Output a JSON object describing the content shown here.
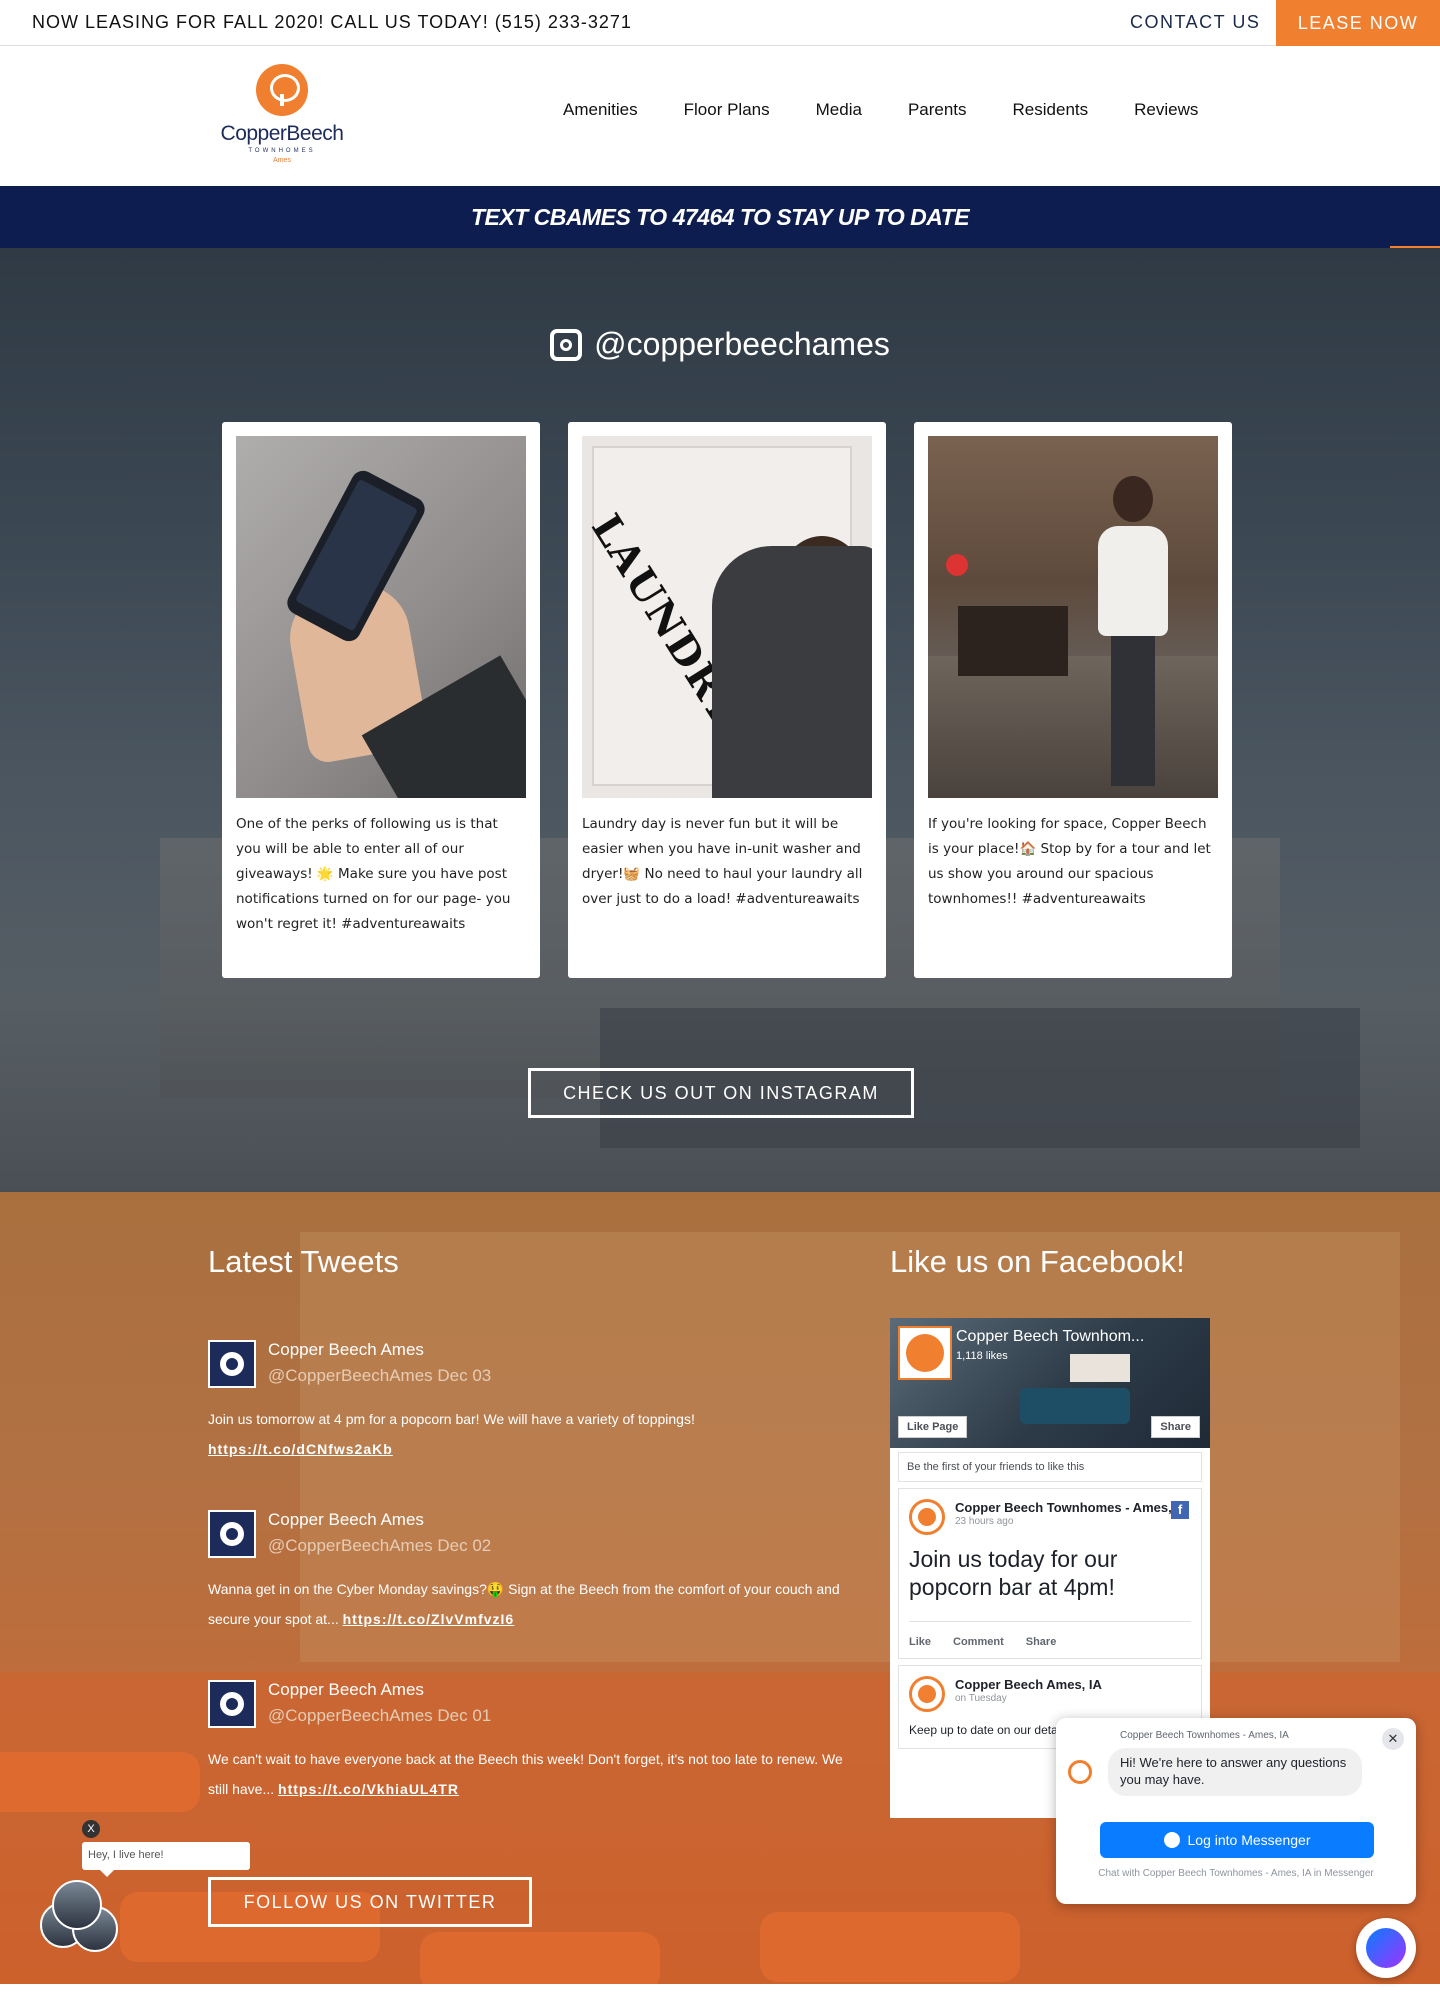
{
  "topbar": {
    "message": "NOW LEASING FOR FALL 2020! CALL US TODAY! (515) 233-3271",
    "contact": "CONTACT US",
    "lease": "LEASE NOW"
  },
  "logo": {
    "name": "CopperBeech",
    "sub": "TOWNHOMES",
    "city": "Ames"
  },
  "nav": {
    "items": [
      "Amenities",
      "Floor Plans",
      "Media",
      "Parents",
      "Residents",
      "Reviews"
    ],
    "active": "Media"
  },
  "text_banner": "TEXT CBAMES TO 47464 TO STAY UP TO DATE",
  "instagram": {
    "handle": "@copperbeechames",
    "posts": [
      {
        "caption": "One of the perks of following us is that you will be able to enter all of our giveaways! 🌟 Make sure you have post notifications turned on for our page- you won't regret it! #adventureawaits"
      },
      {
        "caption": "Laundry day is never fun but it will be easier when you have in-unit washer and dryer!🧺 No need to haul your laundry all over just to do a load! #adventureawaits"
      },
      {
        "caption": "If you're looking for space, Copper Beech is your place!🏠 Stop by for a tour and let us show you around our spacious townhomes!! #adventureawaits"
      }
    ],
    "laundry_word": "LAUNDRY",
    "button": "CHECK US OUT ON INSTAGRAM"
  },
  "tweets": {
    "title": "Latest Tweets",
    "items": [
      {
        "name": "Copper Beech Ames",
        "handle": "@CopperBeechAmes Dec 03",
        "text": "Join us tomorrow at 4 pm for a popcorn bar! We will have a variety of toppings!",
        "link": "https://t.co/dCNfws2aKb"
      },
      {
        "name": "Copper Beech Ames",
        "handle": "@CopperBeechAmes Dec 02",
        "text": "Wanna get in on the Cyber Monday savings?🤑 Sign at the Beech from the comfort of your couch and secure your spot at...",
        "link": "https://t.co/ZlvVmfvzI6"
      },
      {
        "name": "Copper Beech Ames",
        "handle": "@CopperBeechAmes Dec 01",
        "text": "We can't wait to have everyone back at the Beech this week! Don't forget, it's not too late to renew. We still have...",
        "link": "https://t.co/VkhiaUL4TR"
      }
    ],
    "button": "FOLLOW US ON TWITTER"
  },
  "facebook": {
    "title": "Like us on Facebook!",
    "page_name": "Copper Beech Townhom...",
    "likes": "1,118 likes",
    "like_page": "Like Page",
    "share": "Share",
    "friends": "Be the first of your friends to like this",
    "post1": {
      "name": "Copper Beech Townhomes - Ames, IA",
      "time": "23 hours ago",
      "text": "Join us today for our popcorn bar at 4pm!",
      "actions": [
        "Like",
        "Comment",
        "Share"
      ]
    },
    "post2": {
      "name": "Copper Beech Ames, IA",
      "time": "on Tuesday",
      "text": "Keep up to date on our details by following all o"
    }
  },
  "messenger": {
    "title": "Copper Beech Townhomes - Ames, IA",
    "greeting": "Hi! We're here to answer any questions you may have.",
    "button": "Log into Messenger",
    "footer": "Chat with Copper Beech Townhomes - Ames, IA in Messenger",
    "close": "✕"
  },
  "live_chat": {
    "bubble": "Hey, I live here!",
    "close": "X"
  },
  "social_sidebar": {
    "facebook": "f"
  },
  "colors": {
    "orange": "#f08030",
    "navy": "#0d1d4f",
    "messenger_blue": "#0a7cff"
  }
}
